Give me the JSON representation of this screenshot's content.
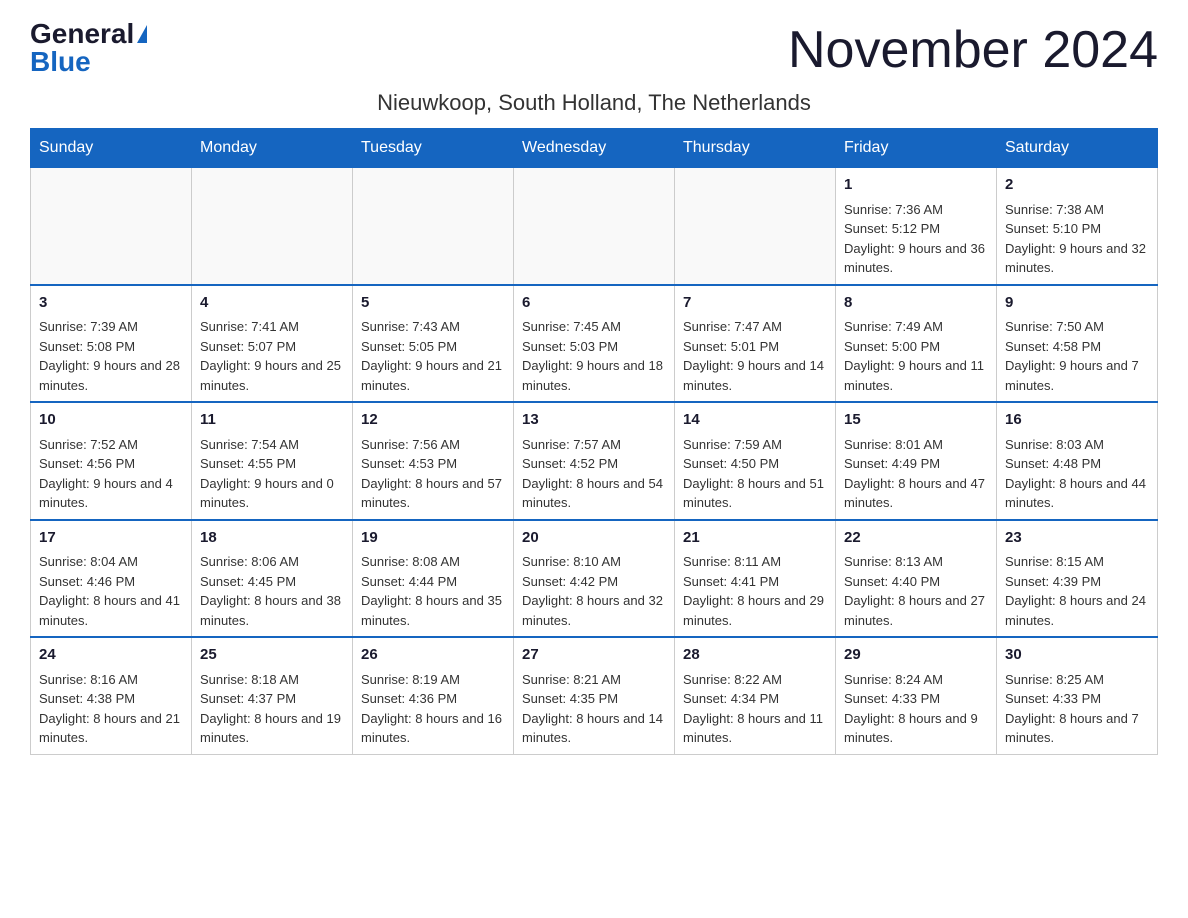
{
  "logo": {
    "general": "General",
    "blue": "Blue"
  },
  "header": {
    "month_year": "November 2024",
    "location": "Nieuwkoop, South Holland, The Netherlands"
  },
  "weekdays": [
    "Sunday",
    "Monday",
    "Tuesday",
    "Wednesday",
    "Thursday",
    "Friday",
    "Saturday"
  ],
  "weeks": [
    [
      {
        "day": "",
        "sunrise": "",
        "sunset": "",
        "daylight": ""
      },
      {
        "day": "",
        "sunrise": "",
        "sunset": "",
        "daylight": ""
      },
      {
        "day": "",
        "sunrise": "",
        "sunset": "",
        "daylight": ""
      },
      {
        "day": "",
        "sunrise": "",
        "sunset": "",
        "daylight": ""
      },
      {
        "day": "",
        "sunrise": "",
        "sunset": "",
        "daylight": ""
      },
      {
        "day": "1",
        "sunrise": "Sunrise: 7:36 AM",
        "sunset": "Sunset: 5:12 PM",
        "daylight": "Daylight: 9 hours and 36 minutes."
      },
      {
        "day": "2",
        "sunrise": "Sunrise: 7:38 AM",
        "sunset": "Sunset: 5:10 PM",
        "daylight": "Daylight: 9 hours and 32 minutes."
      }
    ],
    [
      {
        "day": "3",
        "sunrise": "Sunrise: 7:39 AM",
        "sunset": "Sunset: 5:08 PM",
        "daylight": "Daylight: 9 hours and 28 minutes."
      },
      {
        "day": "4",
        "sunrise": "Sunrise: 7:41 AM",
        "sunset": "Sunset: 5:07 PM",
        "daylight": "Daylight: 9 hours and 25 minutes."
      },
      {
        "day": "5",
        "sunrise": "Sunrise: 7:43 AM",
        "sunset": "Sunset: 5:05 PM",
        "daylight": "Daylight: 9 hours and 21 minutes."
      },
      {
        "day": "6",
        "sunrise": "Sunrise: 7:45 AM",
        "sunset": "Sunset: 5:03 PM",
        "daylight": "Daylight: 9 hours and 18 minutes."
      },
      {
        "day": "7",
        "sunrise": "Sunrise: 7:47 AM",
        "sunset": "Sunset: 5:01 PM",
        "daylight": "Daylight: 9 hours and 14 minutes."
      },
      {
        "day": "8",
        "sunrise": "Sunrise: 7:49 AM",
        "sunset": "Sunset: 5:00 PM",
        "daylight": "Daylight: 9 hours and 11 minutes."
      },
      {
        "day": "9",
        "sunrise": "Sunrise: 7:50 AM",
        "sunset": "Sunset: 4:58 PM",
        "daylight": "Daylight: 9 hours and 7 minutes."
      }
    ],
    [
      {
        "day": "10",
        "sunrise": "Sunrise: 7:52 AM",
        "sunset": "Sunset: 4:56 PM",
        "daylight": "Daylight: 9 hours and 4 minutes."
      },
      {
        "day": "11",
        "sunrise": "Sunrise: 7:54 AM",
        "sunset": "Sunset: 4:55 PM",
        "daylight": "Daylight: 9 hours and 0 minutes."
      },
      {
        "day": "12",
        "sunrise": "Sunrise: 7:56 AM",
        "sunset": "Sunset: 4:53 PM",
        "daylight": "Daylight: 8 hours and 57 minutes."
      },
      {
        "day": "13",
        "sunrise": "Sunrise: 7:57 AM",
        "sunset": "Sunset: 4:52 PM",
        "daylight": "Daylight: 8 hours and 54 minutes."
      },
      {
        "day": "14",
        "sunrise": "Sunrise: 7:59 AM",
        "sunset": "Sunset: 4:50 PM",
        "daylight": "Daylight: 8 hours and 51 minutes."
      },
      {
        "day": "15",
        "sunrise": "Sunrise: 8:01 AM",
        "sunset": "Sunset: 4:49 PM",
        "daylight": "Daylight: 8 hours and 47 minutes."
      },
      {
        "day": "16",
        "sunrise": "Sunrise: 8:03 AM",
        "sunset": "Sunset: 4:48 PM",
        "daylight": "Daylight: 8 hours and 44 minutes."
      }
    ],
    [
      {
        "day": "17",
        "sunrise": "Sunrise: 8:04 AM",
        "sunset": "Sunset: 4:46 PM",
        "daylight": "Daylight: 8 hours and 41 minutes."
      },
      {
        "day": "18",
        "sunrise": "Sunrise: 8:06 AM",
        "sunset": "Sunset: 4:45 PM",
        "daylight": "Daylight: 8 hours and 38 minutes."
      },
      {
        "day": "19",
        "sunrise": "Sunrise: 8:08 AM",
        "sunset": "Sunset: 4:44 PM",
        "daylight": "Daylight: 8 hours and 35 minutes."
      },
      {
        "day": "20",
        "sunrise": "Sunrise: 8:10 AM",
        "sunset": "Sunset: 4:42 PM",
        "daylight": "Daylight: 8 hours and 32 minutes."
      },
      {
        "day": "21",
        "sunrise": "Sunrise: 8:11 AM",
        "sunset": "Sunset: 4:41 PM",
        "daylight": "Daylight: 8 hours and 29 minutes."
      },
      {
        "day": "22",
        "sunrise": "Sunrise: 8:13 AM",
        "sunset": "Sunset: 4:40 PM",
        "daylight": "Daylight: 8 hours and 27 minutes."
      },
      {
        "day": "23",
        "sunrise": "Sunrise: 8:15 AM",
        "sunset": "Sunset: 4:39 PM",
        "daylight": "Daylight: 8 hours and 24 minutes."
      }
    ],
    [
      {
        "day": "24",
        "sunrise": "Sunrise: 8:16 AM",
        "sunset": "Sunset: 4:38 PM",
        "daylight": "Daylight: 8 hours and 21 minutes."
      },
      {
        "day": "25",
        "sunrise": "Sunrise: 8:18 AM",
        "sunset": "Sunset: 4:37 PM",
        "daylight": "Daylight: 8 hours and 19 minutes."
      },
      {
        "day": "26",
        "sunrise": "Sunrise: 8:19 AM",
        "sunset": "Sunset: 4:36 PM",
        "daylight": "Daylight: 8 hours and 16 minutes."
      },
      {
        "day": "27",
        "sunrise": "Sunrise: 8:21 AM",
        "sunset": "Sunset: 4:35 PM",
        "daylight": "Daylight: 8 hours and 14 minutes."
      },
      {
        "day": "28",
        "sunrise": "Sunrise: 8:22 AM",
        "sunset": "Sunset: 4:34 PM",
        "daylight": "Daylight: 8 hours and 11 minutes."
      },
      {
        "day": "29",
        "sunrise": "Sunrise: 8:24 AM",
        "sunset": "Sunset: 4:33 PM",
        "daylight": "Daylight: 8 hours and 9 minutes."
      },
      {
        "day": "30",
        "sunrise": "Sunrise: 8:25 AM",
        "sunset": "Sunset: 4:33 PM",
        "daylight": "Daylight: 8 hours and 7 minutes."
      }
    ]
  ]
}
